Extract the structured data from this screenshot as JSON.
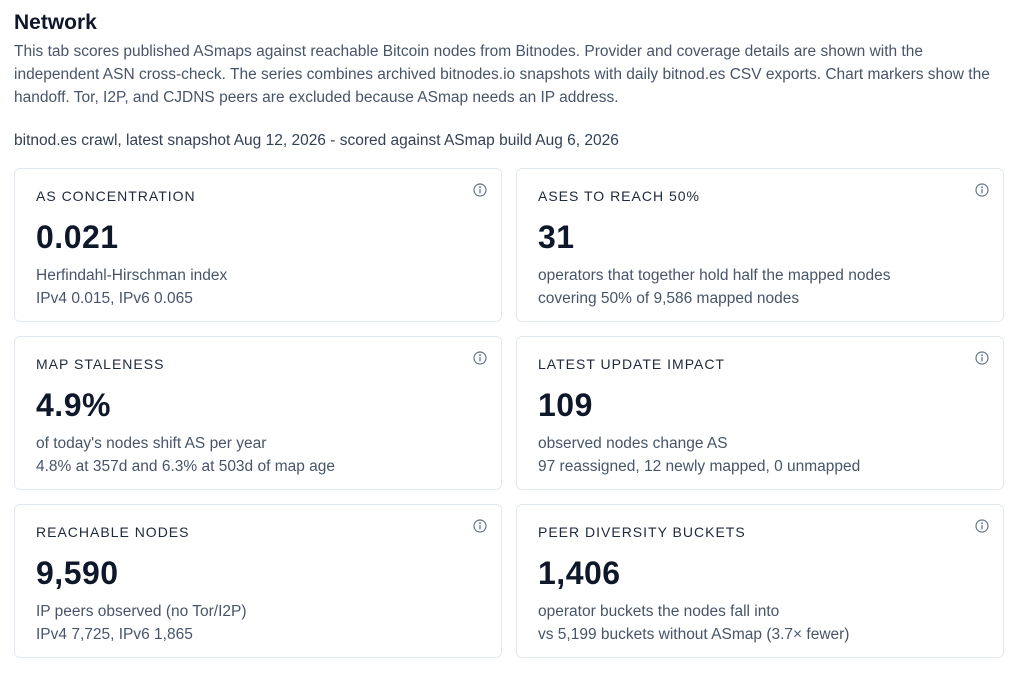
{
  "page": {
    "title": "Network",
    "intro": "This tab scores published ASmaps against reachable Bitcoin nodes from Bitnodes. Provider and coverage details are shown with the independent ASN cross-check. The series combines archived bitnodes.io snapshots with daily bitnod.es CSV exports. Chart markers show the handoff. Tor, I2P, and CJDNS peers are excluded because ASmap needs an IP address.",
    "crawl_info": "bitnod.es crawl, latest snapshot Aug 12, 2026 - scored against ASmap build Aug 6, 2026"
  },
  "cards": [
    {
      "label": "AS CONCENTRATION",
      "value": "0.021",
      "sub": "Herfindahl-Hirschman index",
      "detail": "IPv4 0.015, IPv6 0.065",
      "icon": "info-icon"
    },
    {
      "label": "ASES TO REACH 50%",
      "value": "31",
      "sub": "operators that together hold half the mapped nodes",
      "detail": "covering 50% of 9,586 mapped nodes",
      "icon": "info-icon"
    },
    {
      "label": "MAP STALENESS",
      "value": "4.9%",
      "sub": "of today's nodes shift AS per year",
      "detail": "4.8% at 357d and 6.3% at 503d of map age",
      "icon": "info-icon"
    },
    {
      "label": "LATEST UPDATE IMPACT",
      "value": "109",
      "sub": "observed nodes change AS",
      "detail": "97 reassigned, 12 newly mapped, 0 unmapped",
      "icon": "info-icon"
    },
    {
      "label": "REACHABLE NODES",
      "value": "9,590",
      "sub": "IP peers observed (no Tor/I2P)",
      "detail": "IPv4 7,725, IPv6 1,865",
      "icon": "info-icon"
    },
    {
      "label": "PEER DIVERSITY BUCKETS",
      "value": "1,406",
      "sub": "operator buckets the nodes fall into",
      "detail": "vs 5,199 buckets without ASmap (3.7× fewer)",
      "icon": "info-icon"
    }
  ],
  "colors": {
    "text_primary": "#0f172a",
    "text_secondary": "#475569",
    "card_border": "#e2e8f0",
    "icon": "#64748b"
  }
}
